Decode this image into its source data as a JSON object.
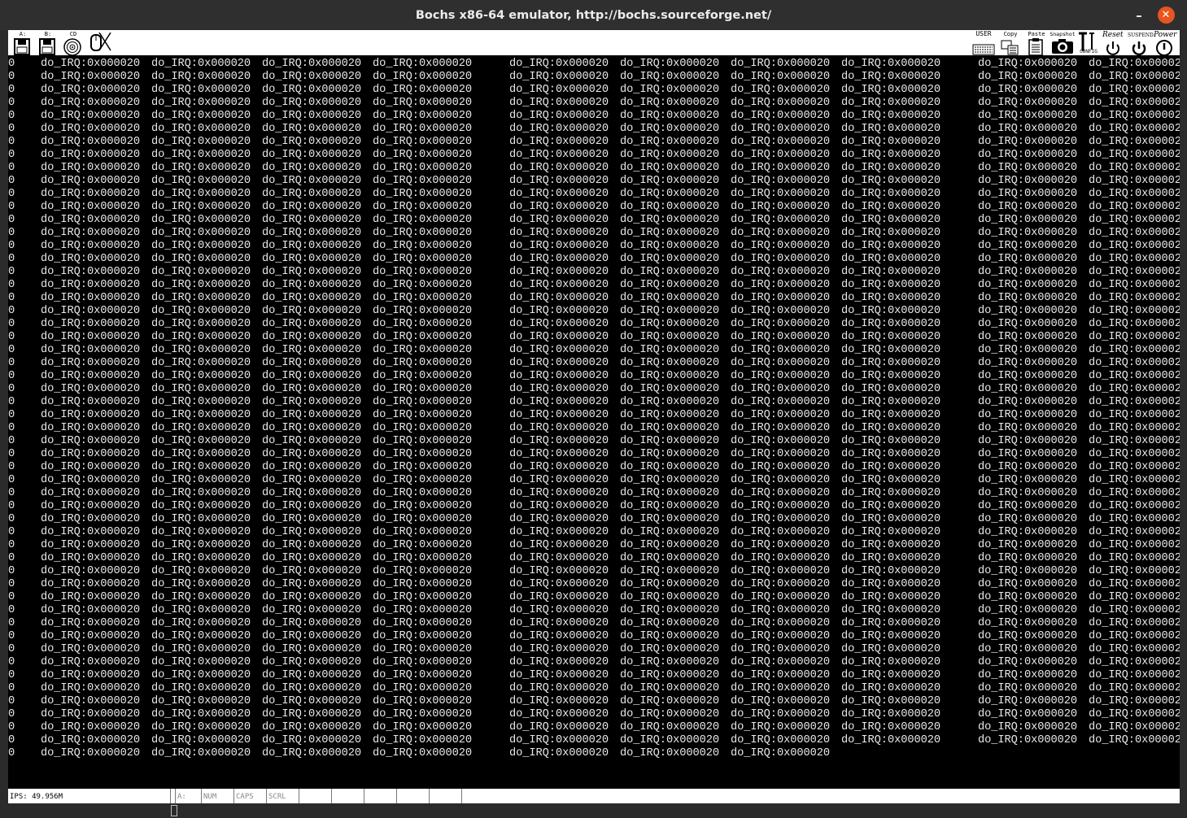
{
  "window": {
    "title": "Bochs x86-64 emulator, http://bochs.sourceforge.net/",
    "minimize_glyph": "–",
    "close_glyph": "✕"
  },
  "toolbar": {
    "left": [
      {
        "id": "floppy-a",
        "label": "A:",
        "icon": "floppy-icon"
      },
      {
        "id": "floppy-b",
        "label": "B:",
        "icon": "floppy-icon"
      },
      {
        "id": "cdrom",
        "label": "CD",
        "icon": "cdrom-icon"
      },
      {
        "id": "mouse",
        "label": "",
        "icon": "mouse-icon"
      }
    ],
    "right": [
      {
        "id": "user",
        "label": "USER",
        "icon": "keyboard-icon"
      },
      {
        "id": "copy",
        "label": "Copy",
        "icon": "copy-icon"
      },
      {
        "id": "paste",
        "label": "Paste",
        "icon": "paste-icon"
      },
      {
        "id": "snapshot",
        "label": "Snapshot",
        "icon": "camera-icon"
      },
      {
        "id": "config",
        "label": "CONFIG",
        "icon": "config-icon"
      },
      {
        "id": "reset",
        "label": "Reset",
        "icon": "reset-icon"
      },
      {
        "id": "suspend",
        "label": "SUSPEND",
        "icon": "suspend-icon"
      },
      {
        "id": "power",
        "label": "Power",
        "icon": "power-icon"
      }
    ]
  },
  "screen": {
    "entry_text": "do_IRQ:0x000020",
    "left_edge_text": "0",
    "last_col_text": "do_IRQ:0x00002",
    "rows": 54,
    "short_rows": 53
  },
  "statusbar": {
    "ips": "IPS: 49.956M",
    "drive": "A:",
    "num": "NUM",
    "caps": "CAPS",
    "scrl": "SCRL"
  },
  "colors": {
    "titlebar": "#2f2f2f",
    "close_button": "#e95420",
    "screen_bg": "#000000",
    "screen_fg": "#e8e8e8"
  }
}
